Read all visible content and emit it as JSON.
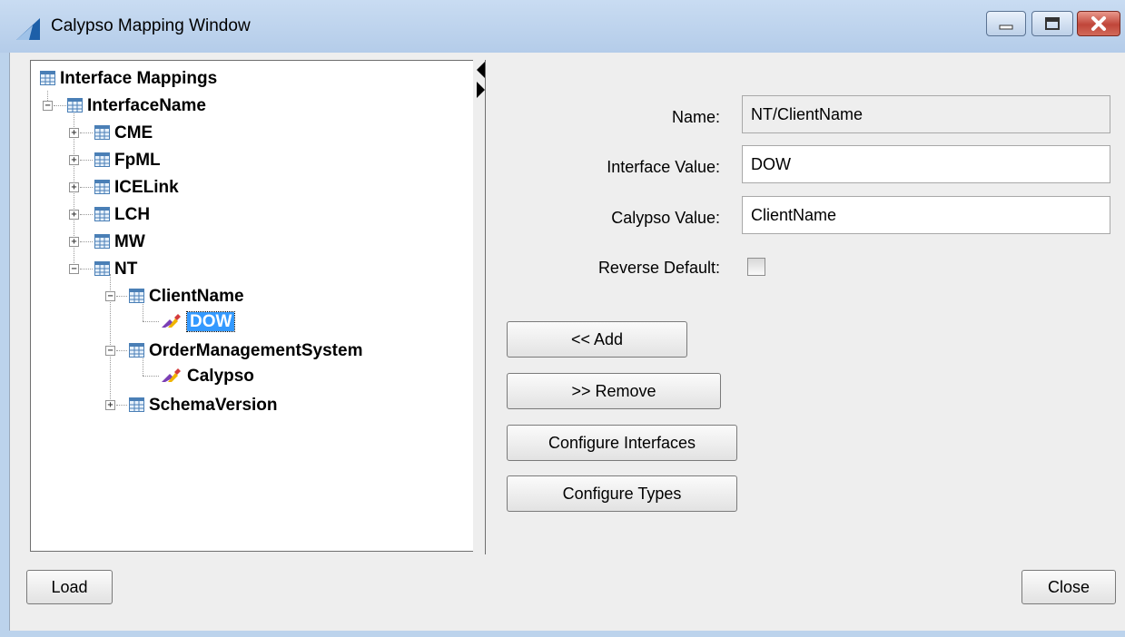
{
  "window": {
    "title": "Calypso Mapping Window"
  },
  "tree": {
    "root": "Interface Mappings",
    "interface_name": "InterfaceName",
    "items": [
      "CME",
      "FpML",
      "ICELink",
      "LCH",
      "MW",
      "NT"
    ],
    "nt_children": {
      "client_name": "ClientName",
      "client_name_value": "DOW",
      "order_mgmt": "OrderManagementSystem",
      "order_mgmt_value": "Calypso",
      "schema_version": "SchemaVersion"
    }
  },
  "form": {
    "name_label": "Name:",
    "name_value": "NT/ClientName",
    "interface_value_label": "Interface Value:",
    "interface_value": "DOW",
    "calypso_value_label": "Calypso Value:",
    "calypso_value": "ClientName",
    "reverse_default_label": "Reverse Default:",
    "reverse_default_checked": false
  },
  "buttons": {
    "add": "<< Add",
    "remove": ">> Remove",
    "configure_interfaces": "Configure Interfaces",
    "configure_types": "Configure Types",
    "load": "Load",
    "close": "Close"
  }
}
